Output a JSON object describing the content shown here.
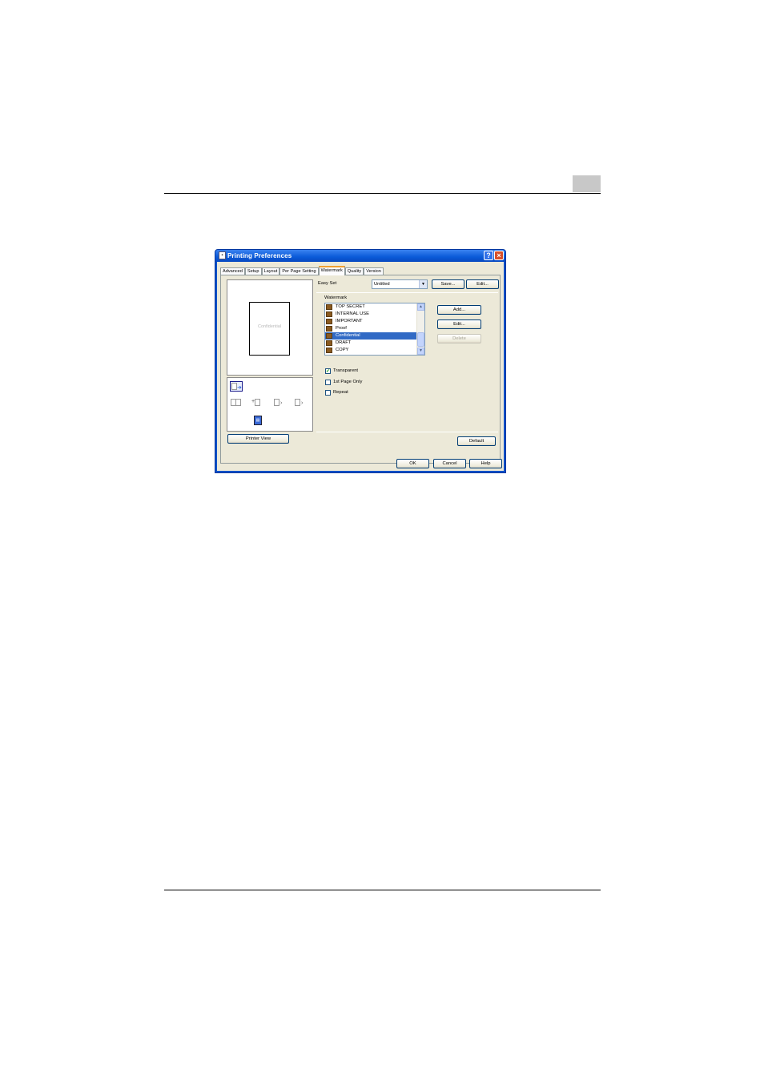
{
  "dialog": {
    "title": "Printing Preferences",
    "help_glyph": "?",
    "close_glyph": "×"
  },
  "tabs": [
    {
      "label": "Advanced"
    },
    {
      "label": "Setup"
    },
    {
      "label": "Layout"
    },
    {
      "label": "Per Page Setting"
    },
    {
      "label": "Watermark",
      "active": true
    },
    {
      "label": "Quality"
    },
    {
      "label": "Version"
    }
  ],
  "preview": {
    "watermark_text": "Confidential",
    "printer_view_label": "Printer View"
  },
  "easyset": {
    "label": "Easy Set",
    "value": "Untitled",
    "save_label": "Save...",
    "edit_label": "Edit..."
  },
  "watermark": {
    "label": "Watermark",
    "items": [
      {
        "label": "TOP SECRET"
      },
      {
        "label": "INTERNAL USE"
      },
      {
        "label": "IMPORTANT"
      },
      {
        "label": "Proof"
      },
      {
        "label": "Confidential",
        "selected": true
      },
      {
        "label": "DRAFT"
      },
      {
        "label": "COPY"
      }
    ],
    "add_label": "Add...",
    "edit_label": "Edit...",
    "delete_label": "Delete"
  },
  "options": {
    "transparent": {
      "label": "Transparent",
      "checked": true
    },
    "first_page_only": {
      "label": "1st Page Only",
      "checked": false
    },
    "repeat": {
      "label": "Repeat",
      "checked": false
    }
  },
  "default_label": "Default",
  "footer": {
    "ok_label": "OK",
    "cancel_label": "Cancel",
    "help_label": "Help"
  }
}
